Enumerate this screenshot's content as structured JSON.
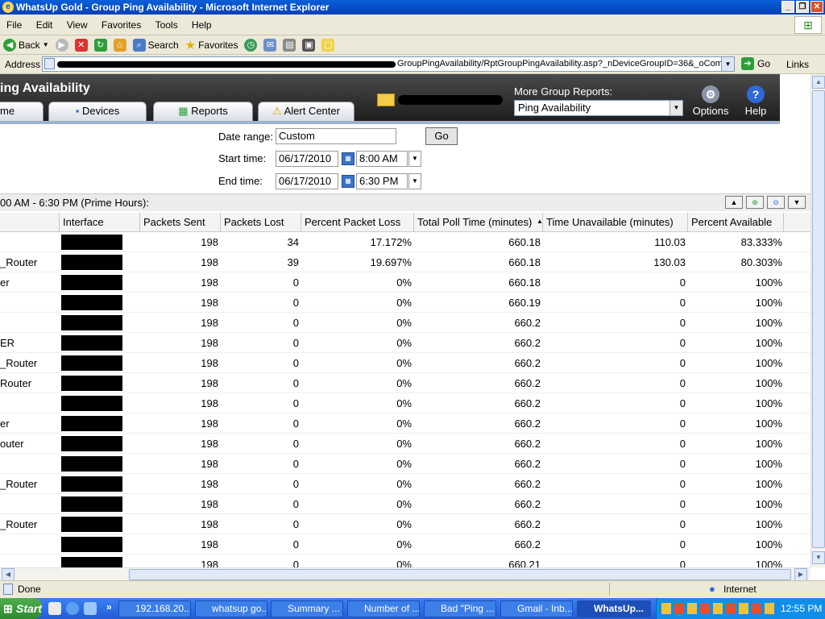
{
  "window": {
    "title": "WhatsUp Gold - Group Ping Availability - Microsoft Internet Explorer"
  },
  "menu": [
    "File",
    "Edit",
    "View",
    "Favorites",
    "Tools",
    "Help"
  ],
  "toolbar": {
    "back": "Back",
    "search": "Search",
    "favorites": "Favorites"
  },
  "address": {
    "label": "Address",
    "url": "GroupPingAvailability/RptGroupPingAvailability.asp?_nDeviceGroupID=36&_oComboDateRange",
    "go": "Go",
    "links": "Links"
  },
  "app": {
    "title": "ing Availability",
    "tabs": [
      "me",
      "Devices",
      "Reports",
      "Alert Center"
    ],
    "more_reports_label": "More Group Reports:",
    "report_select": "Ping Availability",
    "options": "Options",
    "help": "Help"
  },
  "form": {
    "date_range_label": "Date range:",
    "date_range": "Custom",
    "go": "Go",
    "start_label": "Start time:",
    "start_date": "06/17/2010",
    "start_time": "8:00 AM",
    "end_label": "End time:",
    "end_date": "06/17/2010",
    "end_time": "6:30 PM"
  },
  "range_text": "00 AM - 6:30 PM (Prime Hours):",
  "table": {
    "headers": [
      "Interface",
      "Packets Sent",
      "Packets Lost",
      "Percent Packet Loss",
      "Total Poll Time (minutes)",
      "Time Unavailable (minutes)",
      "Percent Available"
    ],
    "rows": [
      {
        "name": "",
        "sent": "198",
        "lost": "34",
        "loss": "17.172%",
        "poll": "660.18",
        "unavail": "110.03",
        "avail": "83.333%"
      },
      {
        "name": "_Router",
        "sent": "198",
        "lost": "39",
        "loss": "19.697%",
        "poll": "660.18",
        "unavail": "130.03",
        "avail": "80.303%"
      },
      {
        "name": "er",
        "sent": "198",
        "lost": "0",
        "loss": "0%",
        "poll": "660.18",
        "unavail": "0",
        "avail": "100%"
      },
      {
        "name": "",
        "sent": "198",
        "lost": "0",
        "loss": "0%",
        "poll": "660.19",
        "unavail": "0",
        "avail": "100%"
      },
      {
        "name": "",
        "sent": "198",
        "lost": "0",
        "loss": "0%",
        "poll": "660.2",
        "unavail": "0",
        "avail": "100%"
      },
      {
        "name": "ER",
        "sent": "198",
        "lost": "0",
        "loss": "0%",
        "poll": "660.2",
        "unavail": "0",
        "avail": "100%"
      },
      {
        "name": "_Router",
        "sent": "198",
        "lost": "0",
        "loss": "0%",
        "poll": "660.2",
        "unavail": "0",
        "avail": "100%"
      },
      {
        "name": "Router",
        "sent": "198",
        "lost": "0",
        "loss": "0%",
        "poll": "660.2",
        "unavail": "0",
        "avail": "100%"
      },
      {
        "name": "",
        "sent": "198",
        "lost": "0",
        "loss": "0%",
        "poll": "660.2",
        "unavail": "0",
        "avail": "100%"
      },
      {
        "name": "er",
        "sent": "198",
        "lost": "0",
        "loss": "0%",
        "poll": "660.2",
        "unavail": "0",
        "avail": "100%"
      },
      {
        "name": "outer",
        "sent": "198",
        "lost": "0",
        "loss": "0%",
        "poll": "660.2",
        "unavail": "0",
        "avail": "100%"
      },
      {
        "name": "",
        "sent": "198",
        "lost": "0",
        "loss": "0%",
        "poll": "660.2",
        "unavail": "0",
        "avail": "100%"
      },
      {
        "name": "_Router",
        "sent": "198",
        "lost": "0",
        "loss": "0%",
        "poll": "660.2",
        "unavail": "0",
        "avail": "100%"
      },
      {
        "name": "",
        "sent": "198",
        "lost": "0",
        "loss": "0%",
        "poll": "660.2",
        "unavail": "0",
        "avail": "100%"
      },
      {
        "name": "_Router",
        "sent": "198",
        "lost": "0",
        "loss": "0%",
        "poll": "660.2",
        "unavail": "0",
        "avail": "100%"
      },
      {
        "name": "",
        "sent": "198",
        "lost": "0",
        "loss": "0%",
        "poll": "660.2",
        "unavail": "0",
        "avail": "100%"
      },
      {
        "name": "",
        "sent": "198",
        "lost": "0",
        "loss": "0%",
        "poll": "660.21",
        "unavail": "0",
        "avail": "100%"
      }
    ]
  },
  "status": {
    "text": "Done",
    "zone": "Internet"
  },
  "taskbar": {
    "start": "Start",
    "tasks": [
      "192.168.20...",
      "whatsup go...",
      "Summary ...",
      "Number of ...",
      "Bad \"Ping ...",
      "Gmail - Inb...",
      "WhatsUp..."
    ],
    "clock": "12:55 PM"
  }
}
